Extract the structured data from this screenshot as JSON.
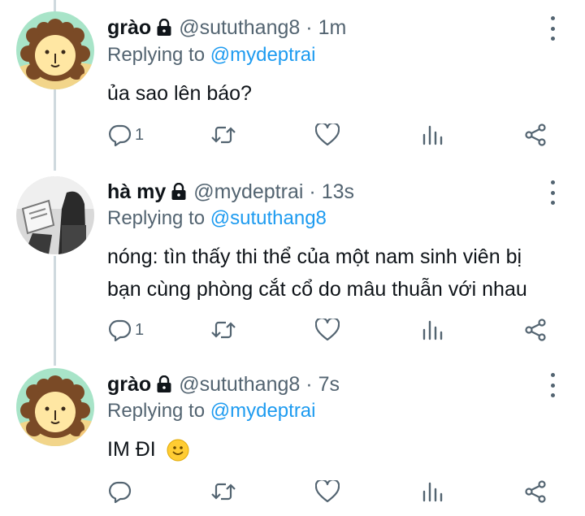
{
  "tweets": [
    {
      "name": "grào",
      "handle": "@sututhang8",
      "separator": "·",
      "time": "1m",
      "replying_label": "Replying to",
      "replying_to": "@mydeptrai",
      "text_lines": [
        "ủa sao lên báo?"
      ],
      "reply_count": "1",
      "avatar": "lion-avatar"
    },
    {
      "name": "hà my",
      "handle": "@mydeptrai",
      "separator": "·",
      "time": "13s",
      "replying_label": "Replying to",
      "replying_to": "@sututhang8",
      "text_lines": [
        "nóng: tìn thấy thi thể của một nam sinh viên bị",
        "bạn cùng phòng cắt cổ do mâu thuẫn với nhau"
      ],
      "reply_count": "1",
      "avatar": "photo-avatar"
    },
    {
      "name": "grào",
      "handle": "@sututhang8",
      "separator": "·",
      "time": "7s",
      "replying_label": "Replying to",
      "replying_to": "@mydeptrai",
      "text_lines": [
        "IM ĐI"
      ],
      "reply_count": "",
      "avatar": "lion-avatar"
    }
  ],
  "colors": {
    "link": "#1d9bf0",
    "secondary": "#536471",
    "thread_line": "#cfd9de",
    "lion_bg": "#a8e4c8",
    "lion_mane": "#7a4a26",
    "lion_face": "#ffe7a3"
  },
  "icons": [
    "lock-icon",
    "reply-icon",
    "retweet-icon",
    "like-icon",
    "views-icon",
    "share-icon",
    "more-icon",
    "smile-emoji"
  ]
}
